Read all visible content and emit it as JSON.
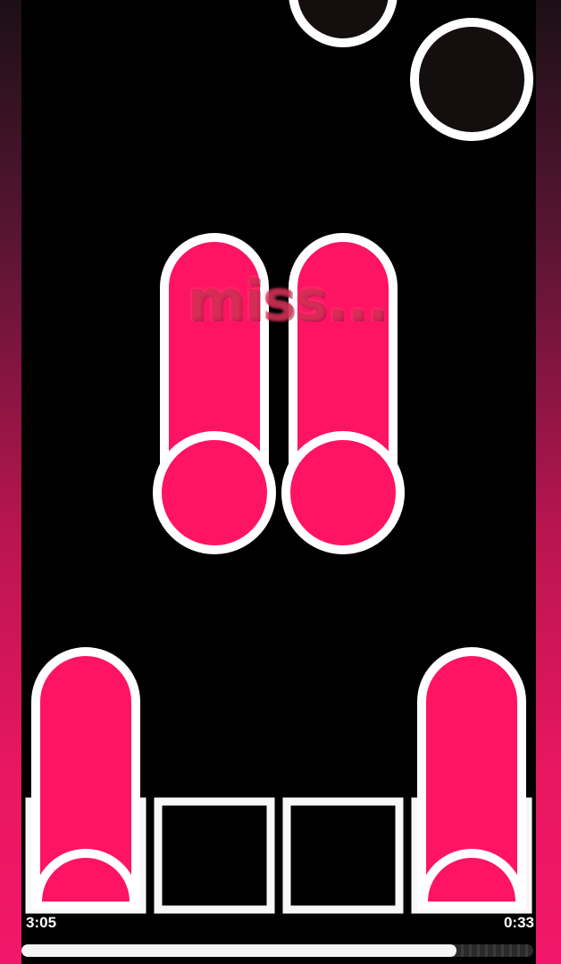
{
  "judgement": {
    "text": "miss..."
  },
  "timer": {
    "elapsed": "3:05",
    "remaining": "0:33"
  },
  "progress": {
    "fraction": 0.85
  },
  "colors": {
    "note_fill": "#ff1464",
    "note_outline": "#ffffff",
    "bomb_fill": "#140e0e",
    "playfield": "#000000",
    "receptor_outline": "#f7f7f7"
  },
  "lanes": [
    {
      "name": "lane-1",
      "receptor_icon": "receptor-square-icon",
      "held": true
    },
    {
      "name": "lane-2",
      "receptor_icon": "receptor-square-icon",
      "held": false
    },
    {
      "name": "lane-3",
      "receptor_icon": "receptor-square-icon",
      "held": false
    },
    {
      "name": "lane-4",
      "receptor_icon": "receptor-square-icon",
      "held": true
    }
  ],
  "falling_objects": [
    {
      "type": "bomb",
      "icon": "bomb-circle-icon"
    },
    {
      "type": "bomb",
      "icon": "bomb-circle-icon"
    },
    {
      "type": "hold-note",
      "icon": "hold-note-icon"
    },
    {
      "type": "hold-note",
      "icon": "hold-note-icon"
    }
  ]
}
